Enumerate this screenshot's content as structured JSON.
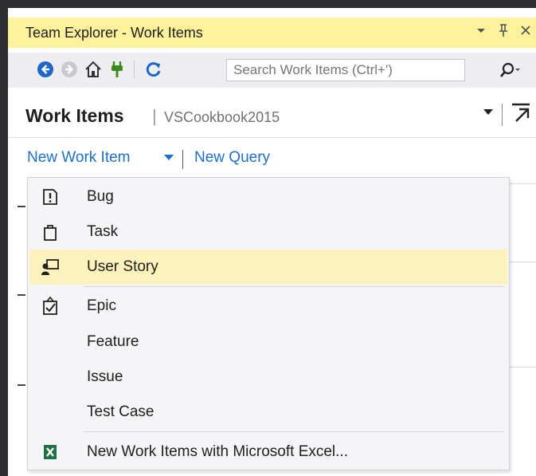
{
  "window": {
    "title": "Team Explorer - Work Items",
    "dropdown_glyph": "▾",
    "pin_glyph": "ᵖ",
    "close_glyph": "✕"
  },
  "toolbar": {
    "search_placeholder": "Search Work Items (Ctrl+')",
    "icons": [
      "back-icon",
      "forward-icon",
      "home-icon",
      "connect-icon",
      "refresh-icon",
      "search-icon"
    ]
  },
  "header": {
    "title": "Work Items",
    "separator": "|",
    "project": "VSCookbook2015"
  },
  "links": {
    "new_work_item": "New Work Item",
    "new_query": "New Query"
  },
  "menu": {
    "items": [
      {
        "label": "Bug",
        "icon": "bug-icon"
      },
      {
        "label": "Task",
        "icon": "task-icon"
      },
      {
        "label": "User Story",
        "icon": "user-story-icon",
        "highlighted": true
      },
      {
        "label": "Epic",
        "icon": "epic-icon"
      },
      {
        "label": "Feature",
        "icon": ""
      },
      {
        "label": "Issue",
        "icon": ""
      },
      {
        "label": "Test Case",
        "icon": ""
      },
      {
        "label": "New Work Items with Microsoft Excel...",
        "icon": "excel-icon"
      }
    ]
  },
  "colors": {
    "title_bar": "#fff29d",
    "link": "#1e6fc7",
    "highlight": "#fdf2bb",
    "excel_green": "#1e7145"
  }
}
